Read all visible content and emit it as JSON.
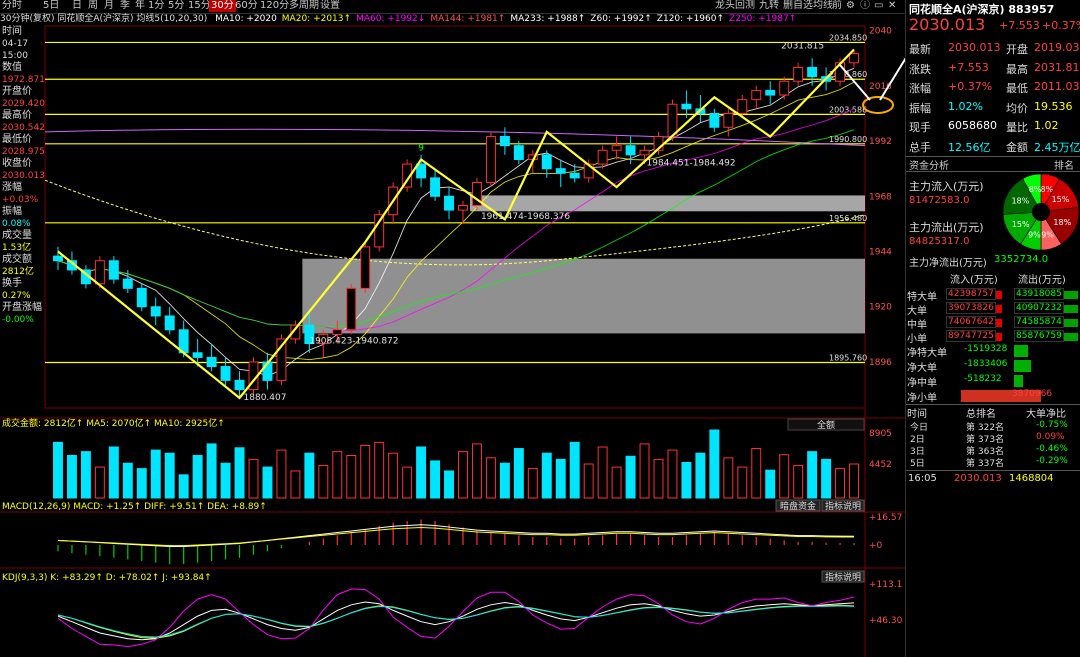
{
  "toolbar": {
    "items": [
      "分时",
      "5日",
      "日",
      "周",
      "月",
      "季",
      "年",
      "1分",
      "5分",
      "15分",
      "30分",
      "60分",
      "120分",
      "多周期",
      "设置"
    ],
    "active_index": 10,
    "right_items": [
      "龙头回测",
      "九转",
      "删自选",
      "均线",
      "前"
    ]
  },
  "indicator_line": {
    "title": "30分钟(复权) 同花顺全A(沪深京) 均线5(10,20,30)",
    "items": [
      {
        "text": "MA10: +2020",
        "color": "#ffffff"
      },
      {
        "text": "MA20: +2013↑",
        "color": "#ffff00"
      },
      {
        "text": "MA60: +1992↓",
        "color": "#ff00ff"
      },
      {
        "text": "MA144: +1981↑",
        "color": "#ff5050"
      },
      {
        "text": "MA233: +1988↑",
        "color": "#ffffff"
      },
      {
        "text": "Z60: +1992↑",
        "color": "#ffffff"
      },
      {
        "text": "Z120: +1960↑",
        "color": "#ffffff"
      },
      {
        "text": "Z250: +1987↑",
        "color": "#ff00ff"
      }
    ]
  },
  "left_panel": {
    "rows": [
      {
        "label": "时间",
        "value": "04-17"
      },
      {
        "label": "",
        "value": "15:00"
      },
      {
        "label": "数值",
        "value": "1972.871",
        "color": "#ff4040"
      },
      {
        "label": "开盘价",
        "value": "2029.420",
        "color": "#ff4040"
      },
      {
        "label": "最高价",
        "value": "2030.542",
        "color": "#ff4040"
      },
      {
        "label": "最低价",
        "value": "2028.975",
        "color": "#ff4040"
      },
      {
        "label": "收盘价",
        "value": "2030.013",
        "color": "#ff4040"
      },
      {
        "label": "涨幅",
        "value": "+0.03%",
        "color": "#ff4040"
      },
      {
        "label": "振幅",
        "value": "0.08%",
        "color": "#00ffff"
      },
      {
        "label": "成交量",
        "value": "1.53亿",
        "color": "#ffff00"
      },
      {
        "label": "成交额",
        "value": "2812亿",
        "color": "#ffff00"
      },
      {
        "label": "换手",
        "value": "0.27%",
        "color": "#ffff00"
      },
      {
        "label": "开盘涨幅",
        "value": "-0.00%",
        "color": "#00ff00"
      }
    ]
  },
  "main_chart_labels": {
    "price_axis": [
      "2040",
      "2016",
      "1992",
      "1968",
      "1944",
      "1920",
      "1896"
    ],
    "hlines": [
      "2034.850",
      "2018.860",
      "2003.586",
      "1990.800",
      "1956.480",
      "1895.760"
    ],
    "high_label": "2031.815",
    "low_label": "1880.407",
    "box_labels": [
      "1961.474-1968.376",
      "1908.423-1940.872",
      "1984.451-1984.492"
    ],
    "td_nine": "9"
  },
  "volume_panel": {
    "header": "成交金额: 2812亿↑  MA5: 2070亿↑  MA10: 2925亿↑",
    "dropdown": "全额",
    "axis": [
      "8905",
      "4452"
    ],
    "buttons": [
      "暗盘资金",
      "指标说明"
    ]
  },
  "macd_panel": {
    "header": "MACD(12,26,9)  MACD: +1.25↑  DIFF: +9.51↑  DEA: +8.89↑",
    "axis": [
      "+16.57",
      "+0"
    ]
  },
  "kdj_panel": {
    "header": "KDJ(9,3,3)  K: +83.29↑  D: +78.02↑  J: +93.84↑",
    "button": "指标说明",
    "axis": [
      "+113.1",
      "+46.30"
    ]
  },
  "right_panel": {
    "title": "同花顺全A(沪深京) 883957",
    "price": "2030.013",
    "change": "+7.553",
    "change_pct": "+0.37%",
    "quote_rows": [
      {
        "k1": "最新",
        "v1": "2030.013",
        "c1": "#ff4040",
        "k2": "开盘",
        "v2": "2019.039",
        "c2": "#ff4040"
      },
      {
        "k1": "涨跌",
        "v1": "+7.553",
        "c1": "#ff4040",
        "k2": "最高",
        "v2": "2031.815",
        "c2": "#ff4040"
      },
      {
        "k1": "涨幅",
        "v1": "+0.37%",
        "c1": "#ff4040",
        "k2": "最低",
        "v2": "2011.034",
        "c2": "#ff4040"
      },
      {
        "k1": "振幅",
        "v1": "1.02%",
        "c1": "#00ffff",
        "k2": "均价",
        "v2": "19.536",
        "c2": "#ffff00"
      },
      {
        "k1": "现手",
        "v1": "6058680",
        "c1": "#ffffff",
        "k2": "量比",
        "v2": "1.02",
        "c2": "#ffff00"
      },
      {
        "k1": "总手",
        "v1": "12.56亿",
        "c1": "#00ffff",
        "k2": "金额",
        "v2": "2.45万亿",
        "c2": "#00ffff"
      }
    ],
    "fund_tab": "资金分析",
    "rank_tab": "排名",
    "inflow_label": "主力流入(万元)",
    "inflow_value": "81472583.0",
    "outflow_label": "主力流出(万元)",
    "outflow_value": "84825317.0",
    "net_label": "主力净流出(万元)",
    "net_value": "3352734.0",
    "pie": [
      {
        "label": "8%",
        "value": 8,
        "color": "#ff0000"
      },
      {
        "label": "15%",
        "value": 15,
        "color": "#cc0000"
      },
      {
        "label": "18%",
        "value": 18,
        "color": "#990000"
      },
      {
        "label": "9%",
        "value": 9,
        "color": "#ff6060"
      },
      {
        "label": "9%",
        "value": 9,
        "color": "#00cc00"
      },
      {
        "label": "15%",
        "value": 15,
        "color": "#00aa00"
      },
      {
        "label": "18%",
        "value": 18,
        "color": "#006600"
      },
      {
        "label": "8%",
        "value": 8,
        "color": "#00ff00"
      }
    ],
    "flow_header": [
      "流入(万元)",
      "流出(万元)"
    ],
    "flow_rows": [
      {
        "name": "特大单",
        "in": "42398757",
        "out": "43918085"
      },
      {
        "name": "大单",
        "in": "39073826",
        "out": "40907232"
      },
      {
        "name": "中单",
        "in": "74067642",
        "out": "74585874"
      },
      {
        "name": "小单",
        "in": "89747725",
        "out": "85876759"
      }
    ],
    "net_rows": [
      {
        "name": "净特大单",
        "value": "-1519328",
        "num": -1519328
      },
      {
        "name": "净大单",
        "value": "-1833406",
        "num": -1833406
      },
      {
        "name": "净中单",
        "value": "-518232",
        "num": -518232
      },
      {
        "name": "净小单",
        "value": "3870966",
        "num": 3870966
      }
    ],
    "rank_header": [
      "时间",
      "总排名",
      "大单净比"
    ],
    "rank_rows": [
      {
        "t": "今日",
        "r": "第 322名",
        "v": "-0.75%",
        "c": "#00ff00"
      },
      {
        "t": "2日",
        "r": "第 373名",
        "v": "0.09%",
        "c": "#ff4040"
      },
      {
        "t": "3日",
        "r": "第 363名",
        "v": "-0.46%",
        "c": "#00ff00"
      },
      {
        "t": "5日",
        "r": "第 337名",
        "v": "-0.29%",
        "c": "#00ff00"
      }
    ],
    "tick": {
      "time": "16:05",
      "price": "2030.013",
      "vol": "1468804"
    }
  },
  "chart_data": {
    "type": "candlestick",
    "title": "",
    "ylim": [
      1876,
      2042
    ],
    "hlines": [
      2034.85,
      2018.86,
      2003.586,
      1990.8,
      1956.48,
      1895.76
    ],
    "boxes": [
      {
        "low": 1961.474,
        "high": 1968.376
      },
      {
        "low": 1908.423,
        "high": 1940.872
      }
    ],
    "candles": [
      [
        1942,
        1946,
        1936,
        1940
      ],
      [
        1940,
        1944,
        1934,
        1936
      ],
      [
        1936,
        1938,
        1928,
        1930
      ],
      [
        1930,
        1942,
        1928,
        1940
      ],
      [
        1940,
        1942,
        1930,
        1932
      ],
      [
        1932,
        1936,
        1926,
        1928
      ],
      [
        1928,
        1930,
        1918,
        1920
      ],
      [
        1920,
        1924,
        1912,
        1916
      ],
      [
        1916,
        1920,
        1908,
        1910
      ],
      [
        1910,
        1914,
        1898,
        1900
      ],
      [
        1900,
        1906,
        1894,
        1898
      ],
      [
        1898,
        1904,
        1892,
        1894
      ],
      [
        1894,
        1898,
        1886,
        1888
      ],
      [
        1888,
        1892,
        1880,
        1884
      ],
      [
        1884,
        1898,
        1882,
        1896
      ],
      [
        1896,
        1900,
        1884,
        1888
      ],
      [
        1888,
        1908,
        1886,
        1906
      ],
      [
        1906,
        1914,
        1904,
        1912
      ],
      [
        1912,
        1918,
        1900,
        1904
      ],
      [
        1904,
        1910,
        1898,
        1908
      ],
      [
        1908,
        1914,
        1904,
        1910
      ],
      [
        1910,
        1930,
        1908,
        1928
      ],
      [
        1928,
        1948,
        1926,
        1946
      ],
      [
        1946,
        1962,
        1944,
        1960
      ],
      [
        1960,
        1974,
        1956,
        1972
      ],
      [
        1972,
        1984,
        1970,
        1982
      ],
      [
        1982,
        1986,
        1972,
        1976
      ],
      [
        1976,
        1980,
        1966,
        1968
      ],
      [
        1968,
        1972,
        1958,
        1962
      ],
      [
        1962,
        1966,
        1956,
        1964
      ],
      [
        1964,
        1976,
        1962,
        1974
      ],
      [
        1974,
        1996,
        1972,
        1994
      ],
      [
        1994,
        1998,
        1986,
        1990
      ],
      [
        1990,
        1992,
        1982,
        1984
      ],
      [
        1984,
        1988,
        1978,
        1986
      ],
      [
        1986,
        1988,
        1976,
        1980
      ],
      [
        1980,
        1984,
        1972,
        1978
      ],
      [
        1978,
        1982,
        1974,
        1976
      ],
      [
        1976,
        1984,
        1974,
        1982
      ],
      [
        1982,
        1990,
        1980,
        1988
      ],
      [
        1988,
        1994,
        1984,
        1990
      ],
      [
        1990,
        1994,
        1982,
        1986
      ],
      [
        1986,
        1990,
        1982,
        1988
      ],
      [
        1988,
        1996,
        1986,
        1994
      ],
      [
        1994,
        2010,
        1992,
        2008
      ],
      [
        2008,
        2014,
        2002,
        2006
      ],
      [
        2006,
        2012,
        2000,
        2004
      ],
      [
        2004,
        2006,
        1996,
        1998
      ],
      [
        1998,
        2006,
        1994,
        2004
      ],
      [
        2004,
        2012,
        2002,
        2010
      ],
      [
        2010,
        2016,
        2006,
        2014
      ],
      [
        2014,
        2018,
        2008,
        2012
      ],
      [
        2012,
        2020,
        2010,
        2018
      ],
      [
        2018,
        2026,
        2016,
        2024
      ],
      [
        2024,
        2028,
        2016,
        2020
      ],
      [
        2020,
        2024,
        2014,
        2018
      ],
      [
        2018,
        2028,
        2016,
        2026
      ],
      [
        2026,
        2031.8,
        2024,
        2030
      ]
    ],
    "zigzag": [
      [
        0,
        1944
      ],
      [
        13,
        1880.4
      ],
      [
        22,
        1948
      ],
      [
        26,
        1984
      ],
      [
        32,
        1958
      ],
      [
        35,
        1996
      ],
      [
        40,
        1972
      ],
      [
        47,
        2011
      ],
      [
        51,
        1994
      ],
      [
        57,
        2031.8
      ]
    ],
    "volume": [
      72,
      55,
      60,
      40,
      66,
      45,
      38,
      62,
      58,
      30,
      55,
      70,
      45,
      65,
      50,
      40,
      62,
      35,
      58,
      42,
      60,
      55,
      68,
      72,
      58,
      40,
      66,
      48,
      35,
      60,
      70,
      52,
      45,
      64,
      38,
      58,
      50,
      72,
      44,
      66,
      40,
      54,
      70,
      50,
      62,
      46,
      58,
      88,
      52,
      40,
      64,
      36,
      56,
      42,
      60,
      50,
      38,
      44
    ],
    "macd": [
      -4,
      -5,
      -6,
      -7,
      -8,
      -9,
      -10,
      -11,
      -12,
      -12,
      -11,
      -10,
      -9,
      -8,
      -6,
      -4,
      -2,
      0,
      2,
      4,
      6,
      8,
      10,
      12,
      14,
      15,
      16,
      15,
      13,
      11,
      9,
      8,
      7,
      6,
      5,
      5,
      4,
      4,
      5,
      6,
      7,
      7,
      6,
      5,
      5,
      6,
      7,
      8,
      7,
      6,
      5,
      4,
      3,
      2,
      2,
      1.5,
      1.3,
      1.25
    ],
    "kdj_k": [
      60,
      50,
      40,
      30,
      25,
      20,
      18,
      20,
      30,
      45,
      60,
      70,
      72,
      65,
      55,
      45,
      38,
      35,
      40,
      55,
      70,
      80,
      85,
      82,
      70,
      60,
      50,
      45,
      50,
      60,
      72,
      80,
      84,
      80,
      70,
      62,
      55,
      52,
      58,
      66,
      74,
      80,
      82,
      78,
      70,
      64,
      60,
      62,
      68,
      74,
      78,
      80,
      82,
      80,
      78,
      80,
      82,
      83.29
    ],
    "kdj_d": [
      62,
      56,
      48,
      40,
      33,
      27,
      22,
      21,
      25,
      33,
      45,
      56,
      63,
      64,
      60,
      54,
      47,
      42,
      41,
      47,
      56,
      66,
      74,
      78,
      76,
      70,
      63,
      57,
      54,
      56,
      62,
      69,
      75,
      77,
      74,
      69,
      64,
      59,
      58,
      61,
      66,
      71,
      75,
      76,
      74,
      71,
      67,
      65,
      66,
      69,
      72,
      75,
      77,
      78,
      78,
      78,
      79,
      78.02
    ],
    "kdj_j": [
      56,
      38,
      24,
      10,
      9,
      6,
      10,
      18,
      40,
      69,
      90,
      98,
      90,
      67,
      45,
      27,
      20,
      21,
      38,
      71,
      98,
      108,
      107,
      90,
      58,
      40,
      24,
      21,
      42,
      68,
      92,
      102,
      102,
      86,
      62,
      48,
      37,
      38,
      58,
      76,
      90,
      98,
      96,
      82,
      62,
      50,
      46,
      56,
      72,
      84,
      90,
      90,
      92,
      84,
      78,
      84,
      88,
      93.84
    ]
  }
}
